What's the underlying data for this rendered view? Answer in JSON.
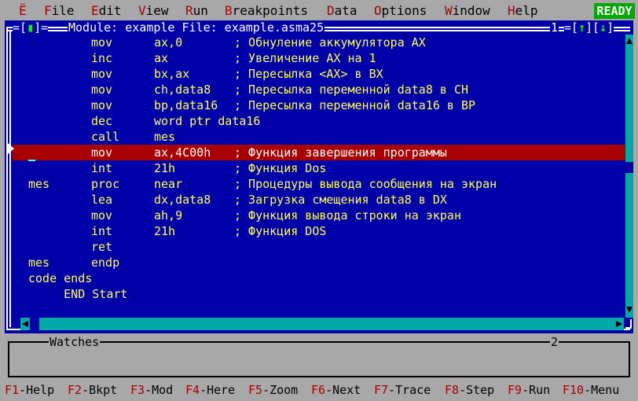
{
  "menu": [
    {
      "hotkey": "Ë",
      "rest": ""
    },
    {
      "hotkey": "F",
      "rest": "ile"
    },
    {
      "hotkey": "E",
      "rest": "dit"
    },
    {
      "hotkey": "V",
      "rest": "iew"
    },
    {
      "hotkey": "R",
      "rest": "un"
    },
    {
      "hotkey": "B",
      "rest": "reakpoints"
    },
    {
      "hotkey": "D",
      "rest": "ata"
    },
    {
      "hotkey": "O",
      "rest": "ptions"
    },
    {
      "hotkey": "W",
      "rest": "indow"
    },
    {
      "hotkey": "H",
      "rest": "elp"
    }
  ],
  "status": "READY",
  "module_window": {
    "close_box": "[▮]",
    "title": "Module: example File: example.asma25",
    "number": "1",
    "up_button": "↑",
    "down_button": "↓"
  },
  "code_lines": [
    {
      "label": "",
      "op": "mov",
      "arg": "ax,0",
      "comment": "; Обнуление аккумулятора AX"
    },
    {
      "label": "",
      "op": "inc",
      "arg": "ax",
      "comment": "; Увеличение AX на 1"
    },
    {
      "label": "",
      "op": "mov",
      "arg": "bx,ax",
      "comment": "; Пересылка <AX> в BX"
    },
    {
      "label": "",
      "op": "mov",
      "arg": "ch,data8",
      "comment": "; Пересылка переменной data8 в CH"
    },
    {
      "label": "",
      "op": "mov",
      "arg": "bp,data16",
      "comment": "; Пересылка переменной data16 в BP"
    },
    {
      "label": "",
      "op": "dec",
      "arg": "word ptr data16",
      "comment": ""
    },
    {
      "label": "",
      "op": "call",
      "arg": "mes",
      "comment": ""
    },
    {
      "label": "",
      "op": "mov",
      "arg": "ax,4C00h",
      "comment": "; Функция завершения программы"
    },
    {
      "label": "",
      "op": "int",
      "arg": "21h",
      "comment": "; Функция Dos"
    },
    {
      "label": "mes",
      "op": "proc",
      "arg": "near",
      "comment": "; Процедуры вывода сообщения на экран"
    },
    {
      "label": "",
      "op": "lea",
      "arg": "dx,data8",
      "comment": "; Загрузка смещения data8 в DX"
    },
    {
      "label": "",
      "op": "mov",
      "arg": "ah,9",
      "comment": "; Функция вывода строки на экран"
    },
    {
      "label": "",
      "op": "int",
      "arg": "21h",
      "comment": "; Функция DOS"
    },
    {
      "label": "",
      "op": "ret",
      "arg": "",
      "comment": ""
    },
    {
      "label": "mes",
      "op": "endp",
      "arg": "",
      "comment": ""
    },
    {
      "label": "code ends",
      "op": "",
      "arg": "",
      "comment": ""
    },
    {
      "label": "     END Start",
      "op": "",
      "arg": "",
      "comment": ""
    }
  ],
  "current_line_index": 7,
  "watches": {
    "title": "Watches",
    "number": "2"
  },
  "function_keys": [
    {
      "key": "F1",
      "label": "-Help"
    },
    {
      "key": "F2",
      "label": "-Bkpt"
    },
    {
      "key": "F3",
      "label": "-Mod"
    },
    {
      "key": "F4",
      "label": "-Here"
    },
    {
      "key": "F5",
      "label": "-Zoom"
    },
    {
      "key": "F6",
      "label": "-Next"
    },
    {
      "key": "F7",
      "label": "-Trace"
    },
    {
      "key": "F8",
      "label": "-Step"
    },
    {
      "key": "F9",
      "label": "-Run"
    },
    {
      "key": "F10",
      "label": "-Menu"
    }
  ],
  "colors": {
    "desktop": "#a8a8a8",
    "window_bg": "#0000a8",
    "code_text": "#ffff55",
    "current_line": "#a80000",
    "hotkey": "#a80000",
    "ready_bg": "#00a800",
    "scrollbar": "#00a8a8"
  }
}
